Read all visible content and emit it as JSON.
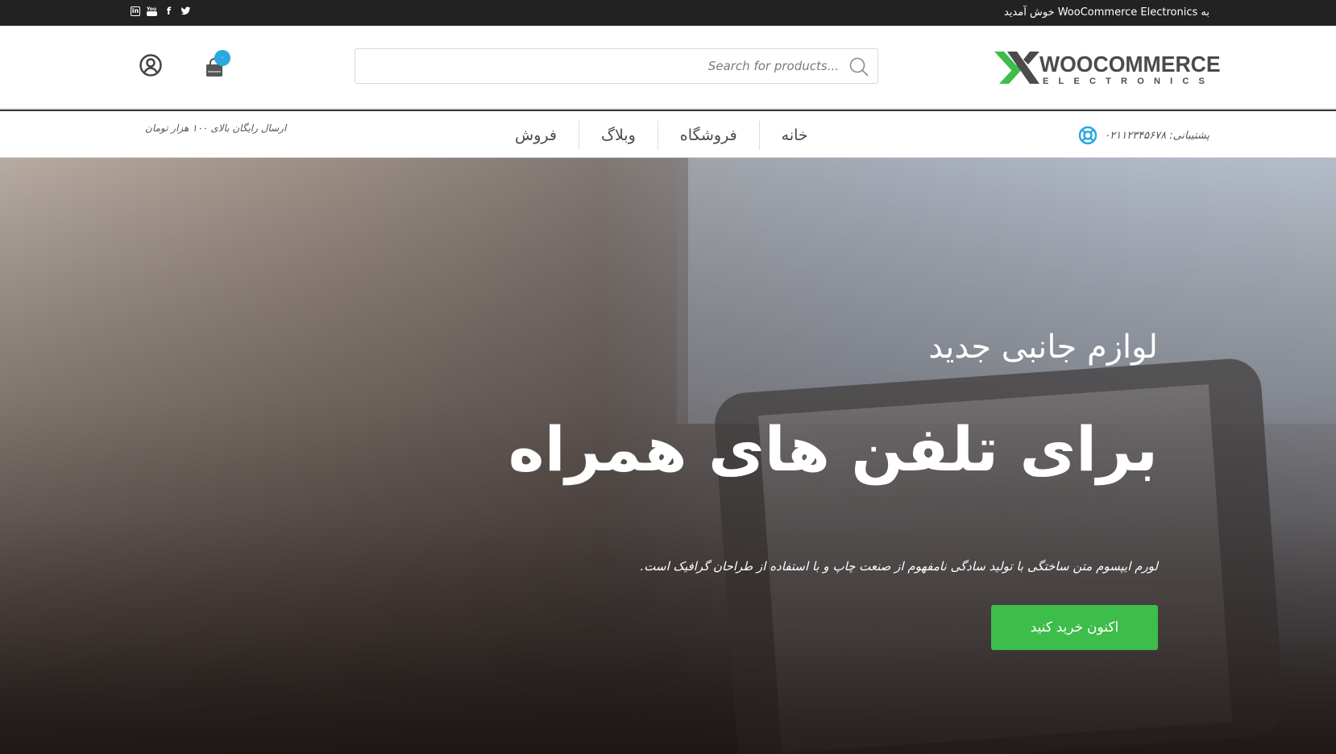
{
  "topbar": {
    "welcome_text": "به WooCommerce Electronics خوش آمدید",
    "social_icons": [
      "twitter-icon",
      "facebook-icon",
      "youtube-icon",
      "linkedin-icon"
    ]
  },
  "header": {
    "logo_title": "WOOCOMMERCE",
    "logo_subtitle": "ELECTRONICS",
    "search_placeholder": "Search for products...",
    "cart_count": "۰"
  },
  "nav": {
    "support_text": "پشتیبانی: ۰۲۱۱۲۳۴۵۶۷۸",
    "menu": [
      "خانه",
      "فروشگاه",
      "وبلاگ",
      "فروش"
    ],
    "shipping_text": "ارسال رایگان بالای ۱۰۰ هزار تومان"
  },
  "hero": {
    "subtitle": "لوازم جانبی جدید",
    "title": "برای تلفن های همراه",
    "description": "لورم ایپسوم متن ساختگی با تولید سادگی نامفهوم از صنعت چاپ و با استفاده از طراحان گرافیک است.",
    "cta_label": "اکنون خرید کنید"
  },
  "colors": {
    "topbar_bg": "#222222",
    "accent_green": "#3dbd4a",
    "badge_blue": "#2aa8e0",
    "logo_green": "#3dbd4a"
  }
}
